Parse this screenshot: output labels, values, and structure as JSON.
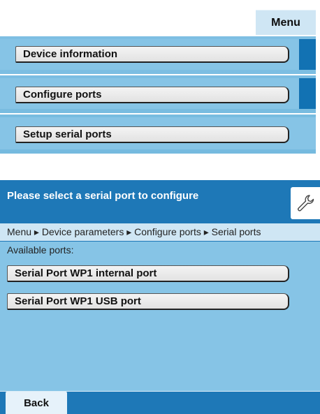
{
  "top_menu": {
    "tab_label": "Menu",
    "items": [
      {
        "label": "Device information"
      },
      {
        "label": "Configure ports"
      },
      {
        "label": "Setup serial ports"
      }
    ]
  },
  "dialog": {
    "title": "Please select a serial port to configure",
    "breadcrumb": "Menu ▸ Device parameters ▸ Configure ports ▸ Serial ports",
    "available_label": "Available ports:",
    "ports": [
      {
        "label": "Serial Port WP1 internal port"
      },
      {
        "label": "Serial Port WP1 USB port"
      }
    ],
    "back_label": "Back",
    "tool_icon": "wrench-icon"
  },
  "colors": {
    "header_blue": "#1e78b7",
    "panel_blue": "#86c4e6",
    "light_blue": "#cfe6f4",
    "button_face": "#eeeeee"
  }
}
